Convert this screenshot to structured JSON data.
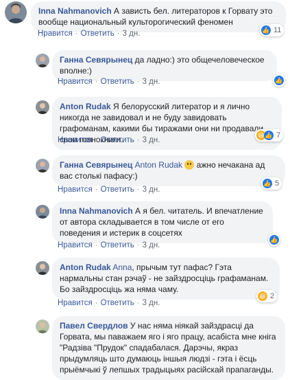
{
  "actions": {
    "like": "Нравится",
    "reply": "Ответить",
    "sep": "·"
  },
  "comments": [
    {
      "author": "Inna Nahmanovich",
      "text": " А зависть бел. литераторов к Горвату это вообще национальный культорогический феномен",
      "time": "3 дн.",
      "reactions": {
        "icons": [
          "like-icon"
        ],
        "count": "11"
      }
    },
    {
      "author": "Ганна Севярынец",
      "text": " да ладно:) это общечеловеческое вполне:)",
      "time": "3 дн.",
      "reactions": {
        "icons": [
          "like-icon"
        ],
        "count": ""
      }
    },
    {
      "author": "Anton Rudak",
      "text": " Я белорусский литератор и я лично никогда не завидовал и не буду завидовать графоманам, какими бы тиражами они ни продавали свои говнокниги.",
      "time": "3 дн.",
      "reactions": {
        "icons": [
          "haha-icon",
          "like-icon"
        ],
        "count": "7"
      }
    },
    {
      "author": "Ганна Севярынец",
      "mention": "Anton Rudak",
      "text": " ажно нечакана ад вас столькі пафасу:)",
      "time": "3 дн.",
      "reactions": {
        "icons": [
          "like-icon"
        ],
        "count": "5"
      }
    },
    {
      "author": "Inna Nahmanovich",
      "text": " А я бел. читатель. И впечатление от автора складывается в том числе от его поведения и истерик в соцсетях",
      "time": "3 дн.",
      "reactions": {
        "icons": [
          "like-icon"
        ],
        "count": ""
      }
    },
    {
      "author": "Anton Rudak",
      "mention": "Anna",
      "text": ", прычым тут пафас? Гэта нармальны стан рэчаў - не зайздросціць графаманам. Бо зайздросціць жа няма чаму.",
      "time": "3 дн.",
      "reactions": {
        "icons": [
          "haha-icon"
        ],
        "count": "2"
      }
    },
    {
      "author": "Павел Свердлов",
      "text": " У нас няма ніякай зайздрасці да Горвата, мы паважаем яго і яго працу, асабіста мне кніга \"Радзіва \"Прудок\" спадабалася. Дарэчы, якраз прыдумляць што думаюць іншыя людзі - гэта і ёсць прыёмчыкі ў лепшых традыцыях расійскай прапаганды.",
      "time": "",
      "reactions": null
    }
  ]
}
